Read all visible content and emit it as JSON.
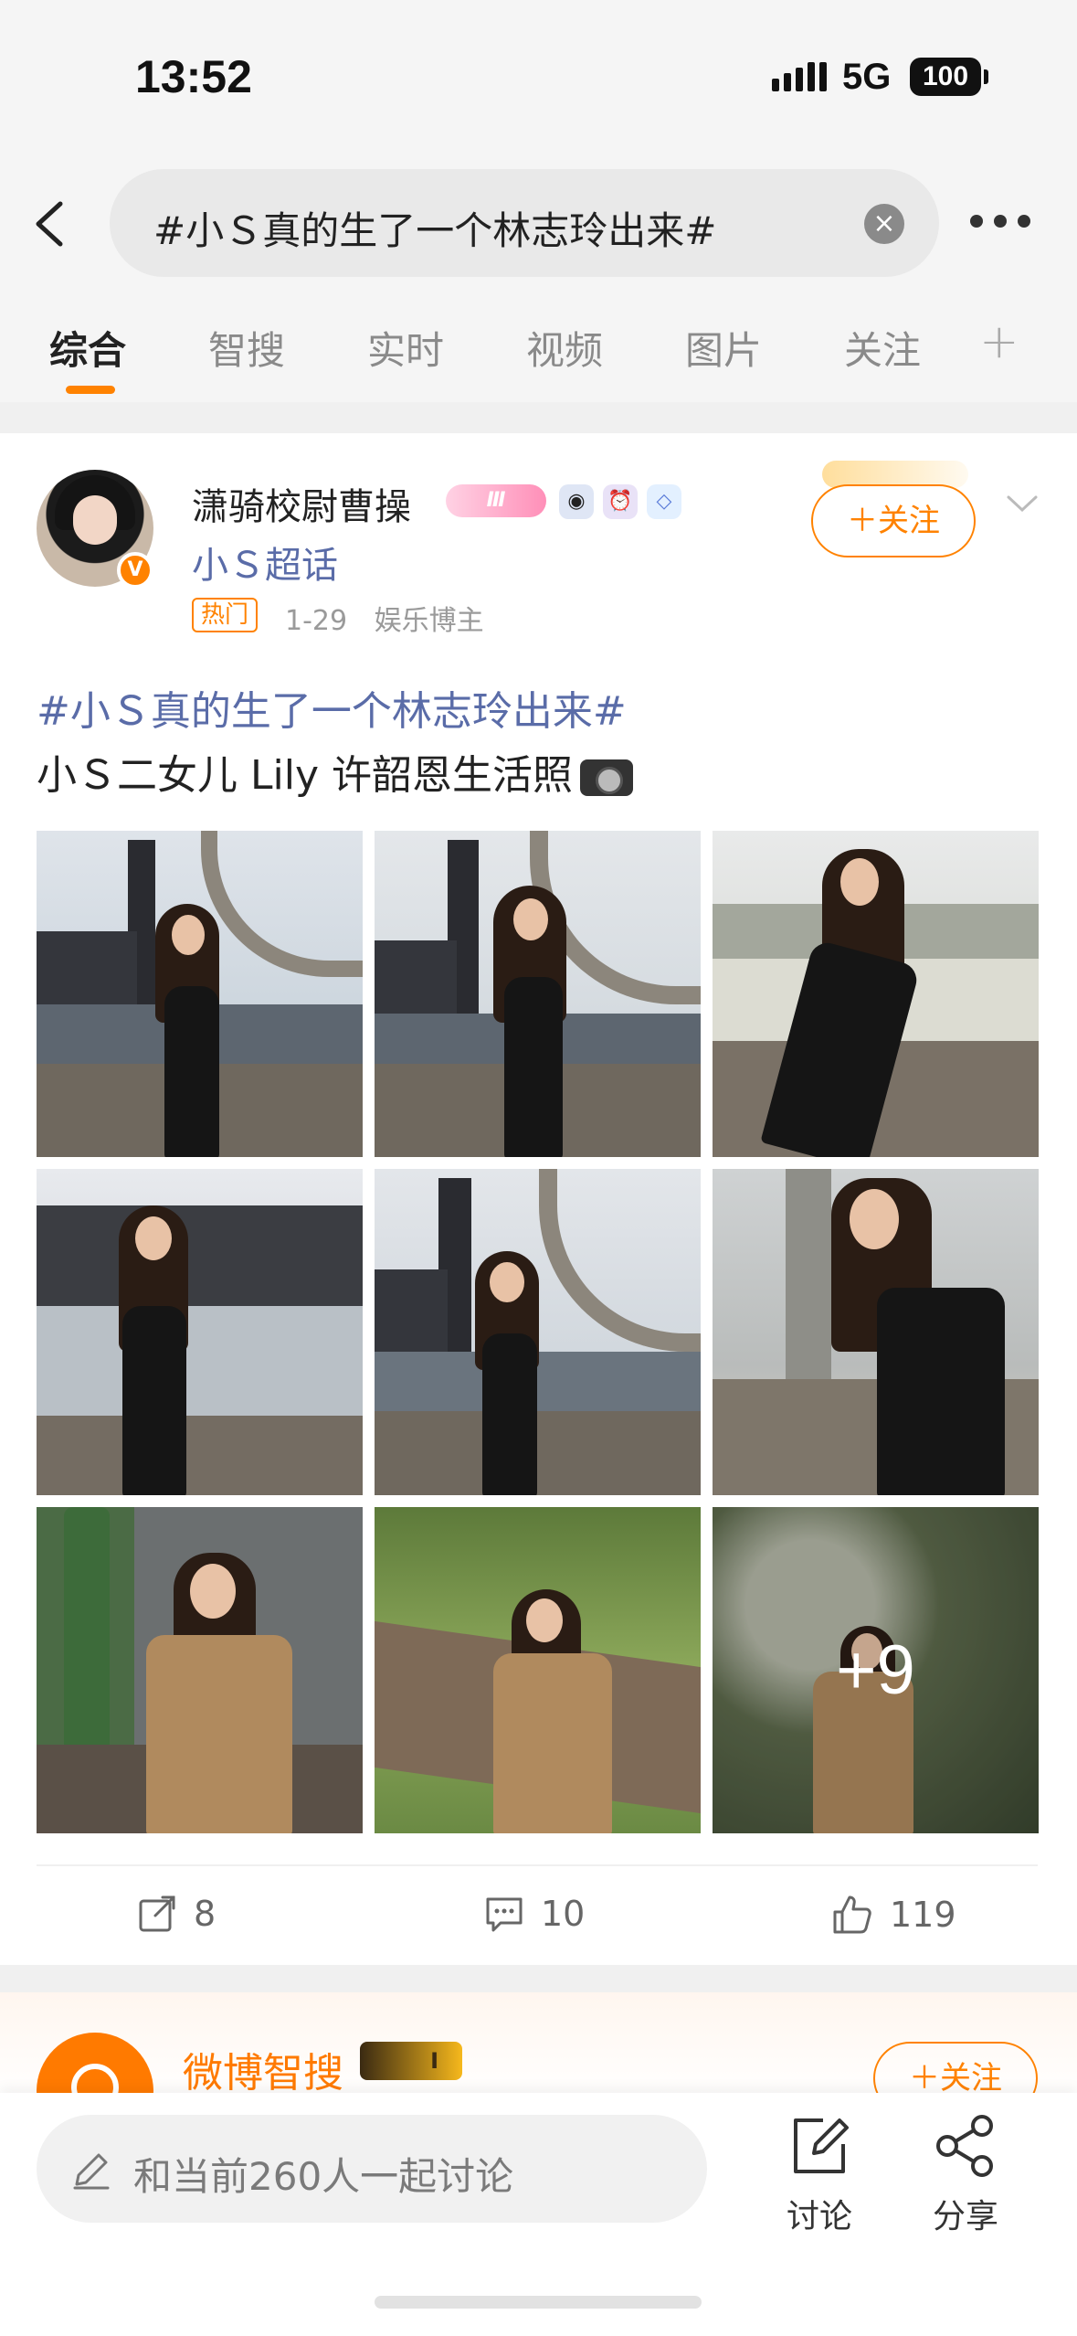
{
  "status_bar": {
    "time": "13:52",
    "network": "5G",
    "battery": "100"
  },
  "search": {
    "query": "#小Ｓ真的生了一个林志玲出来#",
    "clear_symbol": "×"
  },
  "tabs": [
    {
      "label": "综合",
      "active": true
    },
    {
      "label": "智搜"
    },
    {
      "label": "实时"
    },
    {
      "label": "视频"
    },
    {
      "label": "图片"
    },
    {
      "label": "关注"
    }
  ],
  "tab_add": "+",
  "post": {
    "author": "潇骑校尉曹操",
    "level_badge": "Ⅲ",
    "verified_badge": "V",
    "supertopic": "小Ｓ超话",
    "tag": "热门",
    "date": "1-29",
    "role": "娱乐博主",
    "follow_label": "＋关注",
    "topic": "#小Ｓ真的生了一个林志玲出来#",
    "text": "小Ｓ二女儿 Lily 许韶恩生活照",
    "extra_photos": "+9",
    "reposts": "8",
    "comments": "10",
    "likes": "119"
  },
  "next_card": {
    "name": "微博智搜",
    "badge": "Ⅰ",
    "follow_label": "＋关注"
  },
  "bottom_bar": {
    "comment_placeholder": "和当前260人一起讨论",
    "discuss_label": "讨论",
    "share_label": "分享"
  },
  "colors": {
    "accent": "#ff8200",
    "link": "#5a6ca8",
    "text": "#222222",
    "muted": "#9a9a9a"
  }
}
